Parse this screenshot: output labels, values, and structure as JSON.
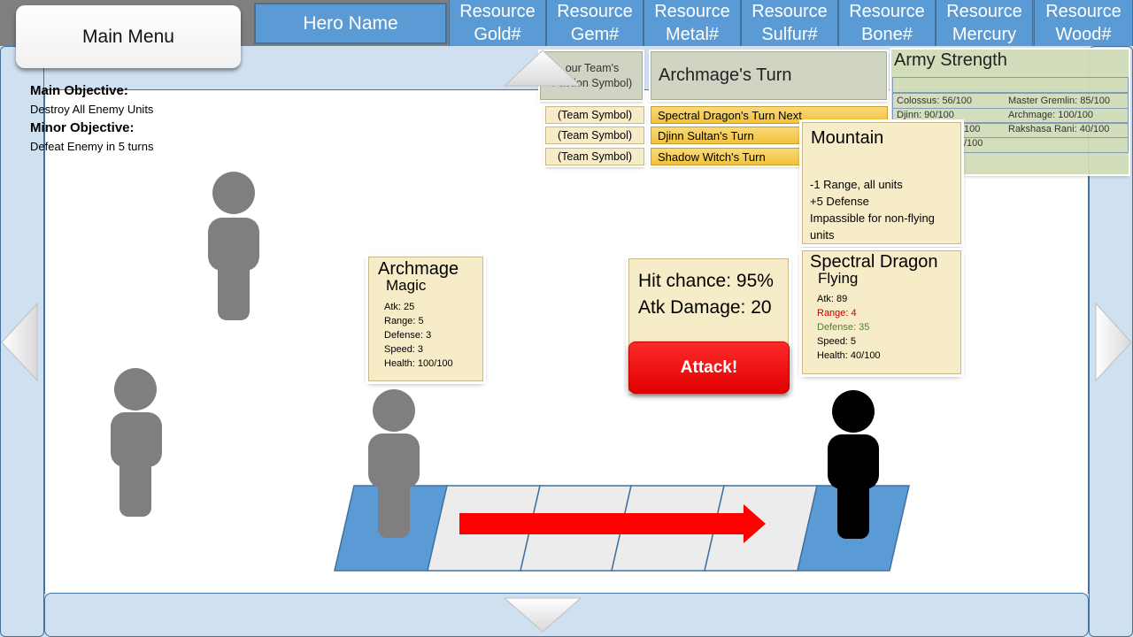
{
  "top_bar": {
    "main_menu_label": "Main Menu",
    "hero_name": "Hero Name",
    "resources": [
      {
        "line1": "Resource",
        "line2": "Gold#"
      },
      {
        "line1": "Resource",
        "line2": "Gem#"
      },
      {
        "line1": "Resource",
        "line2": "Metal#"
      },
      {
        "line1": "Resource",
        "line2": "Sulfur#"
      },
      {
        "line1": "Resource",
        "line2": "Bone#"
      },
      {
        "line1": "Resource",
        "line2": "Mercury"
      },
      {
        "line1": "Resource",
        "line2": "Wood#"
      }
    ]
  },
  "objectives": {
    "main_heading": "Main Objective:",
    "main_text": "Destroy All Enemy Units",
    "minor_heading": "Minor Objective:",
    "minor_text": "Defeat Enemy in 5 turns"
  },
  "turn_order": {
    "faction_symbol_label": "Your Team's Faction Symbol)",
    "faction_line1": "our Team's",
    "faction_line2": "Faction Symbol)",
    "current_turn": "Archmage's Turn",
    "queue": [
      {
        "symbol": "(Team Symbol)",
        "turn": "Spectral Dragon's Turn Next"
      },
      {
        "symbol": "(Team Symbol)",
        "turn": "Djinn Sultan's Turn"
      },
      {
        "symbol": "(Team Symbol)",
        "turn": "Shadow Witch's Turn"
      }
    ]
  },
  "army_strength": {
    "title": "Army Strength",
    "col1": [
      "Colossus: 56/100",
      "Djinn: 90/100",
      "100",
      "/100"
    ],
    "col2": [
      "Master Gremlin: 85/100",
      "Archmage: 100/100",
      "Rakshasa Rani: 40/100"
    ]
  },
  "terrain": {
    "name": "Mountain",
    "effects": [
      "-1 Range, all units",
      "+5 Defense",
      "Impassible for non-flying",
      "units"
    ]
  },
  "attacker": {
    "name": "Archmage",
    "type": "Magic",
    "atk": "Atk: 25",
    "range": "Range: 5",
    "defense": "Defense: 3",
    "speed": "Speed: 3",
    "health": "Health: 100/100"
  },
  "combat": {
    "hit_chance": "Hit chance: 95%",
    "atk_damage": "Atk Damage: 20",
    "attack_label": "Attack!"
  },
  "defender": {
    "name": "Spectral Dragon",
    "type": "Flying",
    "atk": "Atk: 89",
    "range": "Range: 4",
    "defense": "Defense: 35",
    "speed": "Speed: 5",
    "health": "Health: 40/100",
    "range_color": "#c00000",
    "defense_color": "#548235"
  },
  "colors": {
    "resource_blue": "#5b9bd5",
    "frame_blue": "#cfe0f1",
    "card_cream": "#f7ecc8",
    "turn_gold": "#f2c23a",
    "attack_red": "#ff0000",
    "tile_blue": "#5b9bd5",
    "tile_grey": "#ececec"
  },
  "icons": {
    "nav_up": "triangle-up-icon",
    "nav_down": "triangle-down-icon",
    "nav_left": "triangle-left-icon",
    "nav_right": "triangle-right-icon",
    "movement_arrow": "arrow-right-icon"
  }
}
